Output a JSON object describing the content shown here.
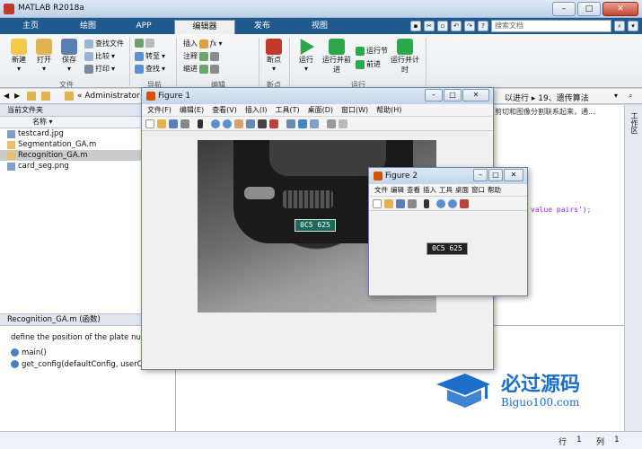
{
  "window": {
    "title": "MATLAB R2018a",
    "minimize": "–",
    "maximize": "□",
    "close": "✕"
  },
  "tabs": [
    {
      "label": "主页"
    },
    {
      "label": "绘图"
    },
    {
      "label": "APP"
    },
    {
      "label": "编辑器"
    },
    {
      "label": "发布"
    },
    {
      "label": "视图"
    }
  ],
  "search": {
    "placeholder": "搜索文档"
  },
  "toolstrip": {
    "new": "新建",
    "open": "打开",
    "save": "保存",
    "find_files": "查找文件",
    "compare": "比较",
    "print": "打印",
    "goto": "转至",
    "find": "查找",
    "insert": "插入",
    "comment": "注释",
    "indent": "缩进",
    "fx": "fx",
    "breakpoint": "断点",
    "run": "运行",
    "run_advance": "运行并前进",
    "run_section": "运行节",
    "advance": "前进",
    "run_time": "运行并计时",
    "sections": {
      "file": "文件",
      "nav": "导航",
      "edit": "编辑",
      "breakpoints": "断点",
      "run": "运行"
    }
  },
  "address": {
    "path": "« Administrator ▸",
    "right": "以进行 ▸ 19、遗传算法"
  },
  "leftpanel": {
    "header": "当前文件夹",
    "col_name": "名称",
    "files": [
      {
        "name": "testcard.jpg"
      },
      {
        "name": "Segmentation_GA.m"
      },
      {
        "name": "Recognition_GA.m"
      },
      {
        "name": "card_seg.png"
      }
    ],
    "details_title": "Recognition_GA.m  (函数)",
    "details_desc": "define the position of the plate num",
    "functions": [
      {
        "name": "main()"
      },
      {
        "name": "get_config(defaultConfig, userCo"
      }
    ]
  },
  "editor": {
    "line1": "剪切和图像分割联系起来，通...",
    "line2": "value pairs');"
  },
  "rightstrip": {
    "label": "工作区"
  },
  "status": {
    "row_label": "行",
    "row": "1",
    "col_label": "列",
    "col": "1"
  },
  "figure1": {
    "title": "Figure 1",
    "menu": [
      "文件(F)",
      "编辑(E)",
      "查看(V)",
      "插入(I)",
      "工具(T)",
      "桌面(D)",
      "窗口(W)",
      "帮助(H)"
    ],
    "plate": "0C5 625"
  },
  "figure2": {
    "title": "Figure 2",
    "menu": [
      "文件",
      "编辑",
      "查看",
      "插入",
      "工具",
      "桌面",
      "窗口",
      "帮助"
    ],
    "plate": "0C5 625"
  },
  "watermark": {
    "title": "必过源码",
    "url": "Biguo100.com"
  },
  "colors": {
    "accent": "#1f5a8f",
    "run_green": "#2aa84a",
    "watermark": "#1e6fc9"
  }
}
